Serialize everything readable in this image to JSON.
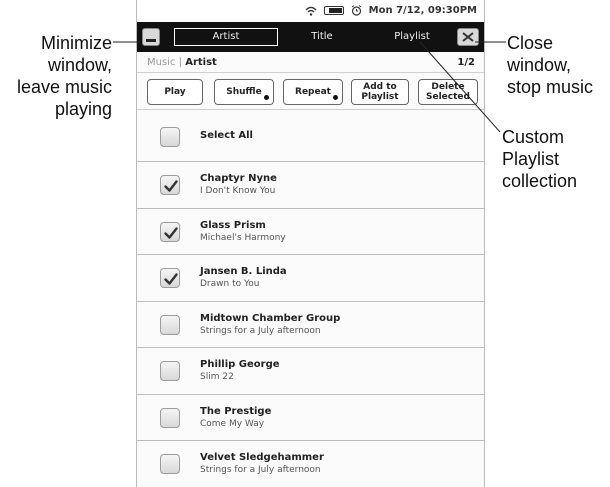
{
  "callouts": {
    "minimize": [
      "Minimize",
      "window,",
      "leave music",
      "playing"
    ],
    "close": [
      "Close",
      "window,",
      "stop music"
    ],
    "playlist": [
      "Custom",
      "Playlist",
      "collection"
    ]
  },
  "status": {
    "datetime": "Mon 7/12, 09:30PM",
    "icons": [
      "wifi-icon",
      "battery-icon",
      "alarm-clock-icon"
    ]
  },
  "titlebar": {
    "tabs": [
      {
        "label": "Artist",
        "selected": true
      },
      {
        "label": "Title",
        "selected": false
      },
      {
        "label": "Playlist",
        "selected": false
      }
    ]
  },
  "breadcrumb": {
    "parent": "Music",
    "separator": "|",
    "current": "Artist",
    "page": "1/2"
  },
  "toolbar": {
    "play": "Play",
    "shuffle": "Shuffle",
    "repeat": "Repeat",
    "add_line1": "Add to",
    "add_line2": "Playlist",
    "delete_line1": "Delete",
    "delete_line2": "Selected"
  },
  "list": {
    "select_all": "Select All",
    "items": [
      {
        "title": "Chaptyr Nyne",
        "subtitle": "I Don't Know You",
        "checked": true
      },
      {
        "title": "Glass Prism",
        "subtitle": "Michael's Harmony",
        "checked": true
      },
      {
        "title": "Jansen B. Linda",
        "subtitle": "Drawn to You",
        "checked": true
      },
      {
        "title": "Midtown Chamber Group",
        "subtitle": "Strings for a July afternoon",
        "checked": false
      },
      {
        "title": "Phillip George",
        "subtitle": "Slim 22",
        "checked": false
      },
      {
        "title": "The Prestige",
        "subtitle": "Come My Way",
        "checked": false
      },
      {
        "title": "Velvet Sledgehammer",
        "subtitle": "Strings for a July afternoon",
        "checked": false
      }
    ]
  }
}
